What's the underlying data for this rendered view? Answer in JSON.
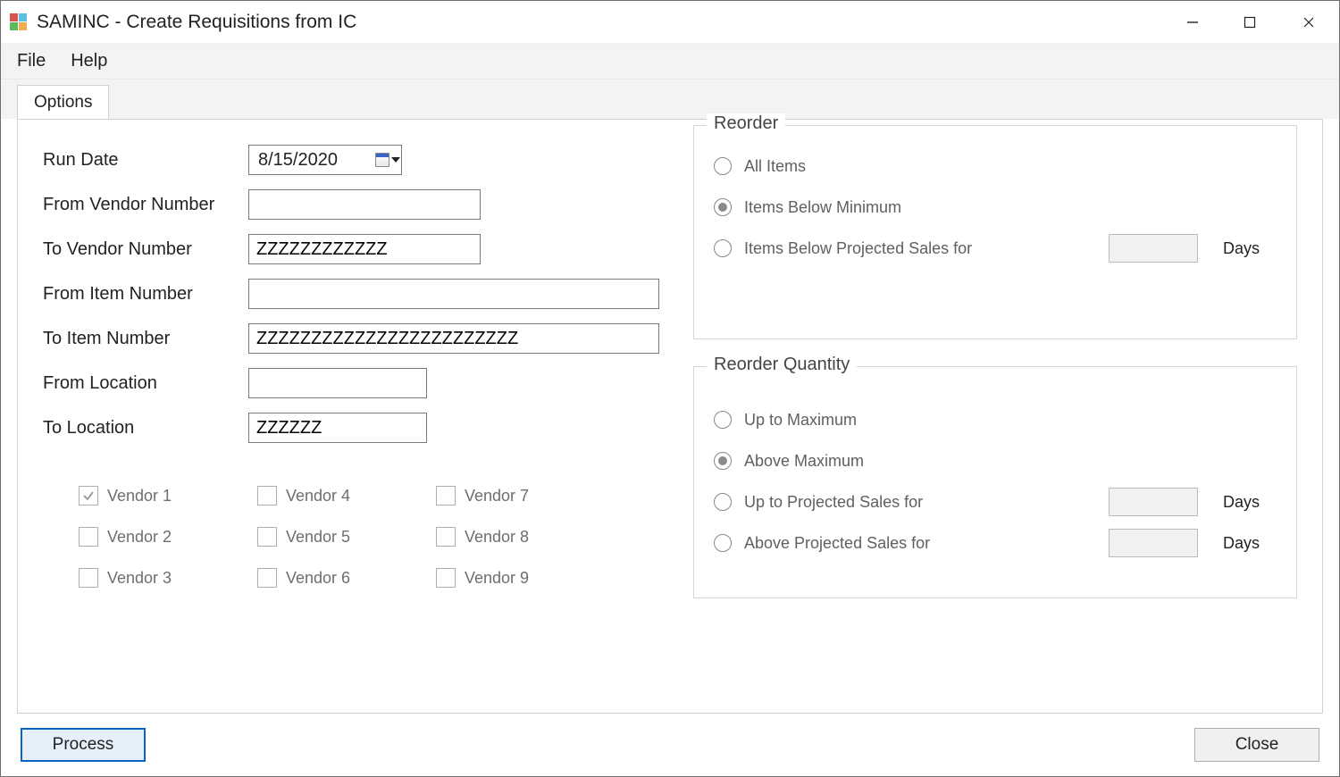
{
  "window": {
    "title": "SAMINC - Create Requisitions from IC"
  },
  "menu": {
    "file": "File",
    "help": "Help"
  },
  "tabs": {
    "options": "Options"
  },
  "form": {
    "run_date_label": "Run Date",
    "run_date_value": "8/15/2020",
    "from_vendor_label": "From Vendor Number",
    "from_vendor_value": "",
    "to_vendor_label": "To Vendor Number",
    "to_vendor_value": "ZZZZZZZZZZZZ",
    "from_item_label": "From Item Number",
    "from_item_value": "",
    "to_item_label": "To Item Number",
    "to_item_value": "ZZZZZZZZZZZZZZZZZZZZZZZZ",
    "from_location_label": "From Location",
    "from_location_value": "",
    "to_location_label": "To Location",
    "to_location_value": "ZZZZZZ"
  },
  "vendors": {
    "v1": "Vendor 1",
    "v2": "Vendor 2",
    "v3": "Vendor 3",
    "v4": "Vendor 4",
    "v5": "Vendor 5",
    "v6": "Vendor 6",
    "v7": "Vendor 7",
    "v8": "Vendor 8",
    "v9": "Vendor 9"
  },
  "reorder": {
    "legend": "Reorder",
    "all": "All Items",
    "below_min": "Items Below Minimum",
    "below_proj": "Items Below Projected Sales for",
    "days": "Days"
  },
  "reorder_qty": {
    "legend": "Reorder Quantity",
    "up_max": "Up to Maximum",
    "above_max": "Above Maximum",
    "up_proj": "Up to Projected Sales for",
    "above_proj": "Above Projected Sales for",
    "days": "Days"
  },
  "buttons": {
    "process": "Process",
    "close": "Close"
  }
}
